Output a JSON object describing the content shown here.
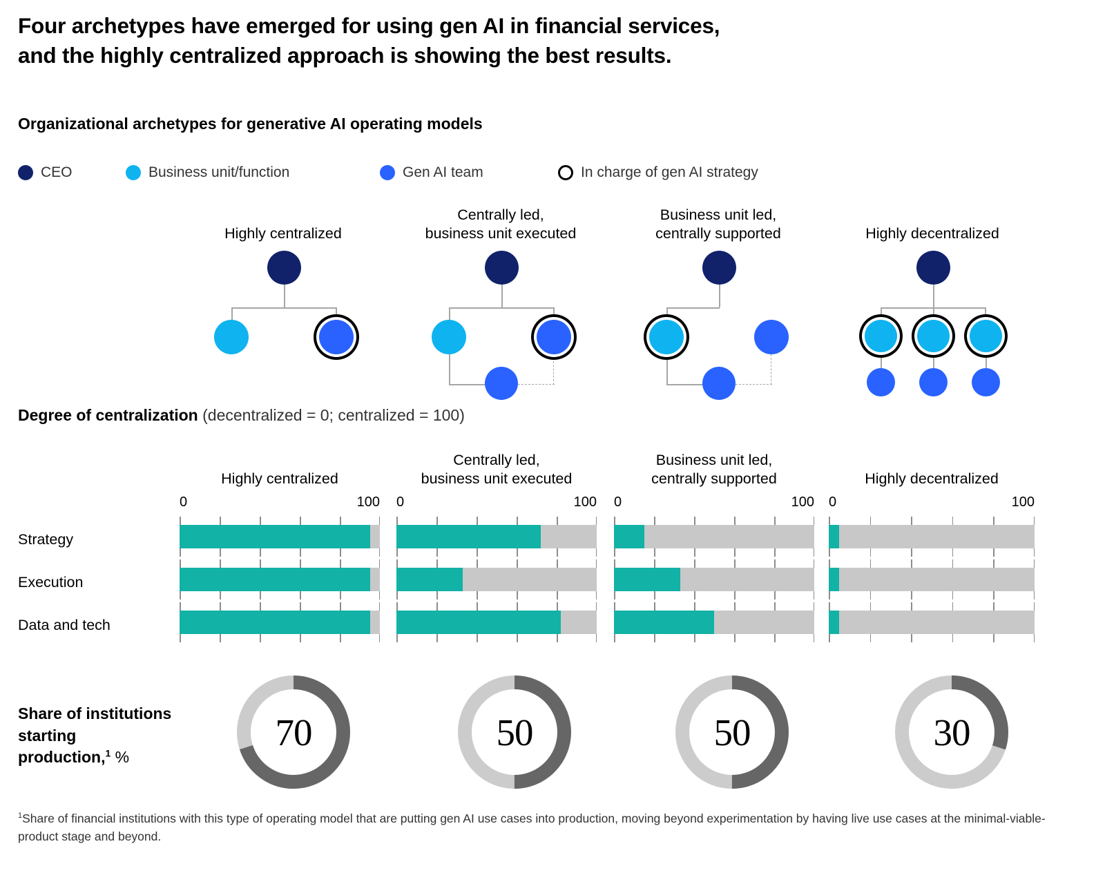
{
  "title": {
    "line1": "Four archetypes have emerged for using gen AI in financial services,",
    "line2": "and the highly centralized approach is showing the best results."
  },
  "section_label": "Organizational archetypes for generative AI operating models",
  "legend": {
    "items": [
      {
        "label": "CEO",
        "type": "dot",
        "color": "#11226b"
      },
      {
        "label": "Business unit/function",
        "type": "dot",
        "color": "#0fb3f0"
      },
      {
        "label": "Gen AI team",
        "type": "dot",
        "color": "#2962ff"
      },
      {
        "label": "In charge of gen AI strategy",
        "type": "ring",
        "color": "#000000"
      }
    ]
  },
  "archetypes": [
    {
      "name": "Highly centralized",
      "line1": "Highly centralized",
      "line2": ""
    },
    {
      "name": "Centrally led, business unit executed",
      "line1": "Centrally led,",
      "line2": "business unit executed"
    },
    {
      "name": "Business unit led, centrally supported",
      "line1": "Business unit led,",
      "line2": "centrally supported"
    },
    {
      "name": "Highly decentralized",
      "line1": "Highly decentralized",
      "line2": ""
    }
  ],
  "degree_label": {
    "bold": "Degree of centralization",
    "normal": " (decentralized = 0; centralized = 100)"
  },
  "axis": {
    "lo": "0",
    "hi": "100",
    "ticks": [
      0,
      20,
      40,
      60,
      80,
      100
    ]
  },
  "row_labels": [
    "Strategy",
    "Execution",
    "Data and tech"
  ],
  "share_label": {
    "line1": "Share of institutions",
    "line2": "starting",
    "line3": "production,",
    "sup": "1",
    "pct": " %"
  },
  "footnote": {
    "sup": "1",
    "text": "Share of financial institutions with this type of operating model that are putting gen AI use cases into production, moving beyond experimentation by having live use cases at the minimal-viable-product stage and beyond."
  },
  "colors": {
    "ceo": "#11226b",
    "business_unit": "#0fb3f0",
    "gen_ai_team": "#2962ff",
    "bar_fill": "#12b2a6",
    "bar_track": "#c8c8c8",
    "donut_fill": "#666666",
    "donut_track": "#cccccc",
    "connector": "#a6a6a6"
  },
  "chart_data": [
    {
      "type": "bar",
      "title": "Degree of centralization (decentralized = 0; centralized = 100)",
      "xlabel": "",
      "ylabel": "",
      "xlim": [
        0,
        100
      ],
      "grid": false,
      "legend": "none",
      "orientation": "horizontal",
      "categories": [
        "Strategy",
        "Execution",
        "Data and tech"
      ],
      "series": [
        {
          "name": "Highly centralized",
          "values": [
            95,
            95,
            95
          ]
        },
        {
          "name": "Centrally led, business unit executed",
          "values": [
            72,
            33,
            82
          ]
        },
        {
          "name": "Business unit led, centrally supported",
          "values": [
            15,
            33,
            50
          ]
        },
        {
          "name": "Highly decentralized",
          "values": [
            5,
            5,
            5
          ]
        }
      ]
    },
    {
      "type": "pie",
      "title": "Share of institutions starting production, %",
      "subtype": "donut",
      "labels": [
        "Highly centralized",
        "Centrally led, business unit executed",
        "Business unit led, centrally supported",
        "Highly decentralized"
      ],
      "values": [
        70,
        50,
        50,
        30
      ],
      "remainder": [
        30,
        50,
        50,
        70
      ]
    }
  ]
}
